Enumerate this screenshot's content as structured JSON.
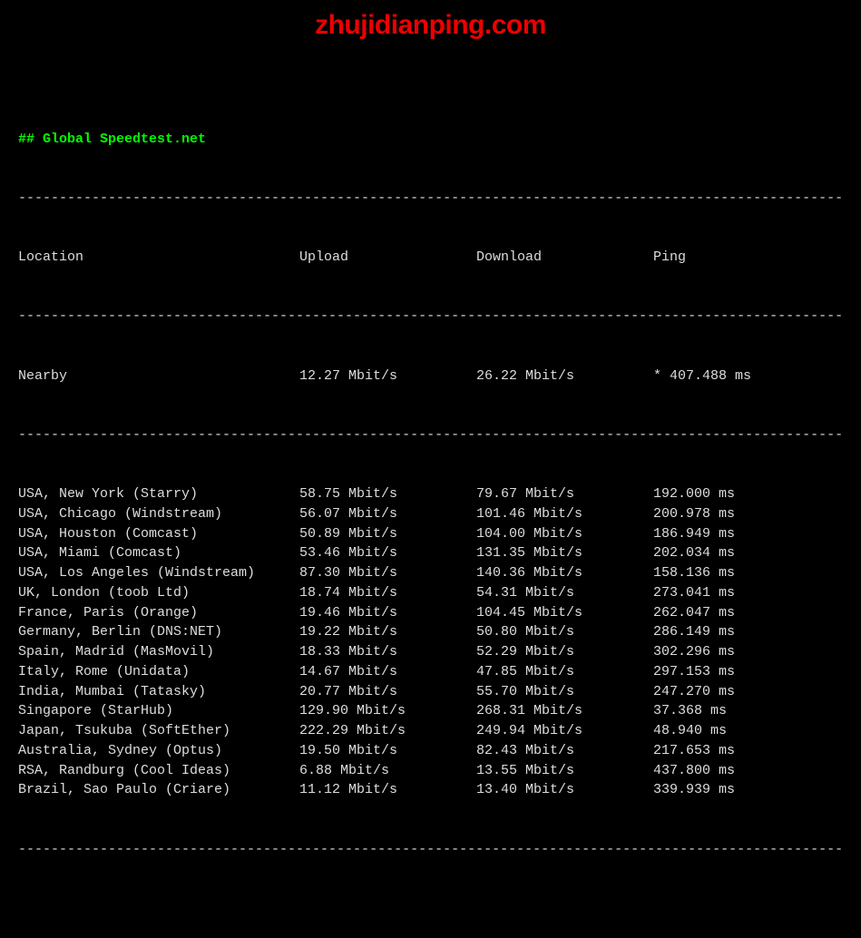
{
  "title": "## Global Speedtest.net",
  "watermark": "zhujidianping.com",
  "divider": "-----------------------------------------------------------------------------------------------------",
  "headers": {
    "location": "Location",
    "upload": "Upload",
    "download": "Download",
    "ping": "Ping"
  },
  "nearby": {
    "location": "Nearby",
    "upload": "12.27 Mbit/s",
    "download": "26.22 Mbit/s",
    "ping": "* 407.488 ms"
  },
  "rows": [
    {
      "location": "USA, New York (Starry)",
      "upload": "58.75 Mbit/s",
      "download": "79.67 Mbit/s",
      "ping": "192.000 ms"
    },
    {
      "location": "USA, Chicago (Windstream)",
      "upload": "56.07 Mbit/s",
      "download": "101.46 Mbit/s",
      "ping": "200.978 ms"
    },
    {
      "location": "USA, Houston (Comcast)",
      "upload": "50.89 Mbit/s",
      "download": "104.00 Mbit/s",
      "ping": "186.949 ms"
    },
    {
      "location": "USA, Miami (Comcast)",
      "upload": "53.46 Mbit/s",
      "download": "131.35 Mbit/s",
      "ping": "202.034 ms"
    },
    {
      "location": "USA, Los Angeles (Windstream)",
      "upload": "87.30 Mbit/s",
      "download": "140.36 Mbit/s",
      "ping": "158.136 ms"
    },
    {
      "location": "UK, London (toob Ltd)",
      "upload": "18.74 Mbit/s",
      "download": "54.31 Mbit/s",
      "ping": "273.041 ms"
    },
    {
      "location": "France, Paris (Orange)",
      "upload": "19.46 Mbit/s",
      "download": "104.45 Mbit/s",
      "ping": "262.047 ms"
    },
    {
      "location": "Germany, Berlin (DNS:NET)",
      "upload": "19.22 Mbit/s",
      "download": "50.80 Mbit/s",
      "ping": "286.149 ms"
    },
    {
      "location": "Spain, Madrid (MasMovil)",
      "upload": "18.33 Mbit/s",
      "download": "52.29 Mbit/s",
      "ping": "302.296 ms"
    },
    {
      "location": "Italy, Rome (Unidata)",
      "upload": "14.67 Mbit/s",
      "download": "47.85 Mbit/s",
      "ping": "297.153 ms"
    },
    {
      "location": "India, Mumbai (Tatasky)",
      "upload": "20.77 Mbit/s",
      "download": "55.70 Mbit/s",
      "ping": "247.270 ms"
    },
    {
      "location": "Singapore (StarHub)",
      "upload": "129.90 Mbit/s",
      "download": "268.31 Mbit/s",
      "ping": "37.368 ms"
    },
    {
      "location": "Japan, Tsukuba (SoftEther)",
      "upload": "222.29 Mbit/s",
      "download": "249.94 Mbit/s",
      "ping": "48.940 ms"
    },
    {
      "location": "Australia, Sydney (Optus)",
      "upload": "19.50 Mbit/s",
      "download": "82.43 Mbit/s",
      "ping": "217.653 ms"
    },
    {
      "location": "RSA, Randburg (Cool Ideas)",
      "upload": "6.88 Mbit/s",
      "download": "13.55 Mbit/s",
      "ping": "437.800 ms"
    },
    {
      "location": "Brazil, Sao Paulo (Criare)",
      "upload": "11.12 Mbit/s",
      "download": "13.40 Mbit/s",
      "ping": "339.939 ms"
    }
  ]
}
